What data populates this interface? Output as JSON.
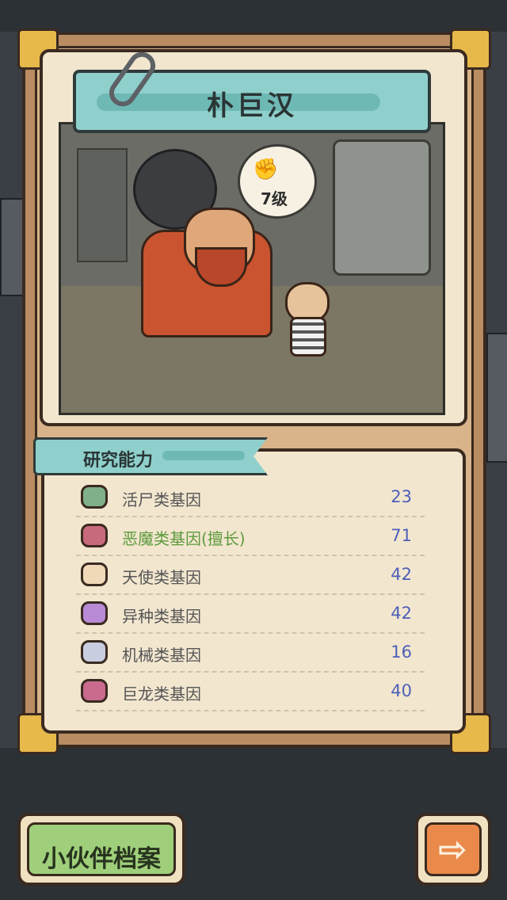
{
  "character": {
    "name": "朴巨汉",
    "level_label": "7级"
  },
  "research": {
    "title": "研究能力",
    "genes": [
      {
        "label": "活尸类基因",
        "value": "23",
        "icon": "zombie-icon",
        "color": "#7fb08a"
      },
      {
        "label": "恶魔类基因(擅长)",
        "value": "71",
        "icon": "demon-icon",
        "color": "#c96a7c",
        "specialty": true
      },
      {
        "label": "天使类基因",
        "value": "42",
        "icon": "angel-icon",
        "color": "#f0d9b8"
      },
      {
        "label": "异种类基因",
        "value": "42",
        "icon": "alien-icon",
        "color": "#b98ad6"
      },
      {
        "label": "机械类基因",
        "value": "16",
        "icon": "robot-icon",
        "color": "#c9cde0"
      },
      {
        "label": "巨龙类基因",
        "value": "40",
        "icon": "dragon-icon",
        "color": "#c96a8e"
      }
    ]
  },
  "buttons": {
    "partner_archive": "小伙伴档案",
    "next": "⇨"
  }
}
